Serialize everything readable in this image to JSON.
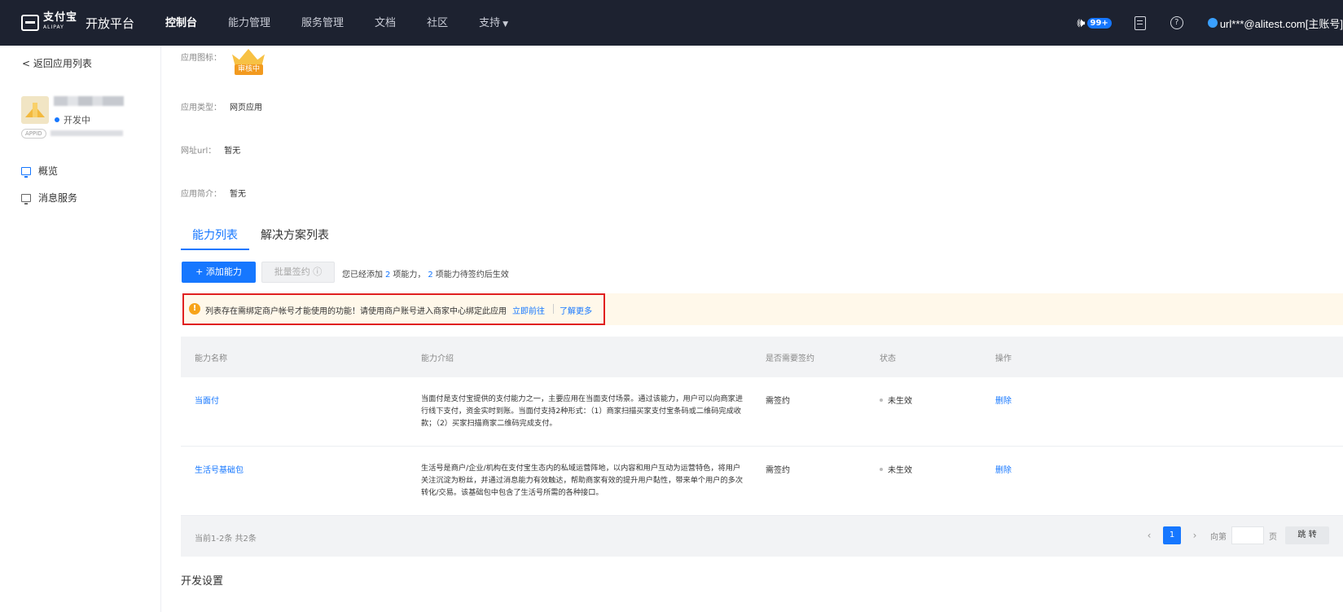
{
  "topbar": {
    "logo_text": "支付宝",
    "logo_sub": "ALIPAY",
    "platform": "开放平台",
    "nav": [
      {
        "label": "控制台"
      },
      {
        "label": "能力管理"
      },
      {
        "label": "服务管理"
      },
      {
        "label": "文档"
      },
      {
        "label": "社区"
      },
      {
        "label": "支持"
      }
    ],
    "notification_count": "99+",
    "user": "url***@alitest.com[主账号]"
  },
  "sidebar": {
    "back": "< 返回应用列表",
    "status": "开发中",
    "appid_tag": "APPID",
    "items": [
      {
        "label": "概览"
      },
      {
        "label": "消息服务"
      }
    ]
  },
  "info": {
    "icon_label": "应用图标：",
    "icon_tag": "审核中",
    "type_label": "应用类型：",
    "type_value": "网页应用",
    "url_label": "网址url：",
    "url_value": "暂无",
    "intro_label": "应用简介：",
    "intro_value": "暂无"
  },
  "tabs": [
    {
      "label": "能力列表",
      "active": true
    },
    {
      "label": "解决方案列表",
      "active": false
    }
  ],
  "actions": {
    "add": "+ 添加能力",
    "batch": "批量签约 ⓘ",
    "summary_pre": "您已经添加",
    "summary_n1": "2",
    "summary_mid": "项能力，",
    "summary_n2": "2",
    "summary_post": "项能力待签约后生效"
  },
  "notice": {
    "text": "列表存在需绑定商户帐号才能使用的功能！请使用商户账号进入商家中心绑定此应用",
    "link1": "立即前往",
    "link2": "了解更多"
  },
  "table": {
    "headers": [
      "能力名称",
      "能力介绍",
      "是否需要签约",
      "状态",
      "操作"
    ],
    "rows": [
      {
        "name": "当面付",
        "desc": "当面付是支付宝提供的支付能力之一，主要应用在当面支付场景。通过该能力，用户可以向商家进行线下支付，资金实时到账。当面付支持2种形式：（1）商家扫描买家支付宝条码或二维码完成收款；（2）买家扫描商家二维码完成支付。",
        "sign": "需签约",
        "status": "未生效",
        "op": "删除"
      },
      {
        "name": "生活号基础包",
        "desc": "生活号是商户/企业/机构在支付宝生态内的私域运营阵地，以内容和用户互动为运营特色，将用户关注沉淀为粉丝，并通过消息能力有效触达，帮助商家有效的提升用户黏性，带来单个用户的多次转化/交易。该基础包中包含了生活号所需的各种接口。",
        "sign": "需签约",
        "status": "未生效",
        "op": "删除"
      }
    ],
    "total": "当前1-2条 共2条",
    "page": "1",
    "goto_pre": "向第",
    "goto_post": "页",
    "go": "跳 转"
  },
  "section_title": "开发设置"
}
